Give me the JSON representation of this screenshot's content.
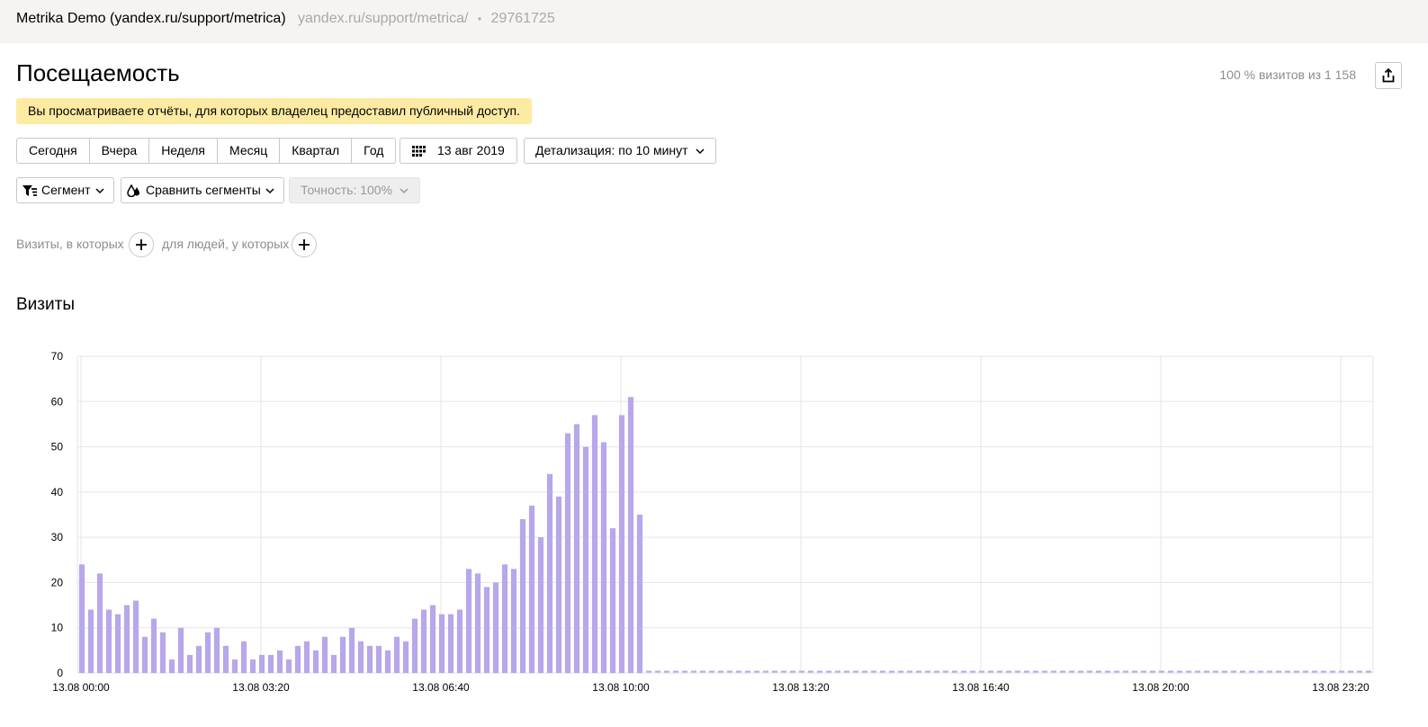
{
  "header": {
    "site_name": "Metrika Demo (yandex.ru/support/metrica)",
    "site_url": "yandex.ru/support/metrica/",
    "separator": "•",
    "counter_id": "29761725"
  },
  "page": {
    "title": "Посещаемость",
    "visits_summary": "100 % визитов из 1 158",
    "share_icon": "share-icon",
    "notice": "Вы просматриваете отчёты, для которых владелец предоставил публичный доступ."
  },
  "toolbar": {
    "periods": [
      "Сегодня",
      "Вчера",
      "Неделя",
      "Месяц",
      "Квартал",
      "Год"
    ],
    "date_label": "13 авг 2019",
    "detail_label": "Детализация: по 10 минут",
    "segment_label": "Сегмент",
    "compare_label": "Сравнить сегменты",
    "accuracy_label": "Точность: 100%"
  },
  "segments": {
    "visits_label": "Визиты, в которых",
    "people_label": "для людей, у которых"
  },
  "chart_section": {
    "title": "Визиты"
  },
  "colors": {
    "bar": "#b8a7ea",
    "grid": "#e6e6e6",
    "notice": "#fdeba4"
  },
  "chart_data": {
    "type": "bar",
    "interval_minutes": 10,
    "x_start": "13.08 00:00",
    "x_end": "13.08 23:50",
    "x_tick_labels": [
      "13.08 00:00",
      "13.08 03:20",
      "13.08 06:40",
      "13.08 10:00",
      "13.08 13:20",
      "13.08 16:40",
      "13.08 20:00",
      "13.08 23:20"
    ],
    "y_ticks": [
      0,
      10,
      20,
      30,
      40,
      50,
      60,
      70
    ],
    "ylim": [
      0,
      70
    ],
    "grid": true,
    "series": [
      {
        "values": [
          24,
          14,
          22,
          14,
          13,
          15,
          16,
          8,
          12,
          9,
          3,
          10,
          4,
          6,
          9,
          10,
          6,
          3,
          7,
          3,
          4,
          4,
          5,
          3,
          6,
          7,
          5,
          8,
          4,
          8,
          10,
          7,
          6,
          6,
          5,
          8,
          7,
          12,
          14,
          15,
          13,
          13,
          14,
          23,
          22,
          19,
          20,
          24,
          23,
          34,
          37,
          30,
          44,
          39,
          53,
          55,
          50,
          57,
          51,
          32,
          57,
          61,
          35,
          0,
          0,
          0,
          0,
          0,
          0,
          0,
          0,
          0,
          0,
          0,
          0,
          0,
          0,
          0,
          0,
          0,
          0,
          0,
          0,
          0,
          0,
          0,
          0,
          0,
          0,
          0,
          0,
          0,
          0,
          0,
          0,
          0,
          0,
          0,
          0,
          0,
          0,
          0,
          0,
          0,
          0,
          0,
          0,
          0,
          0,
          0,
          0,
          0,
          0,
          0,
          0,
          0,
          0,
          0,
          0,
          0,
          0,
          0,
          0,
          0,
          0,
          0,
          0,
          0,
          0,
          0,
          0,
          0,
          0,
          0,
          0,
          0,
          0,
          0,
          0,
          0,
          0,
          0,
          0,
          0
        ]
      }
    ]
  }
}
